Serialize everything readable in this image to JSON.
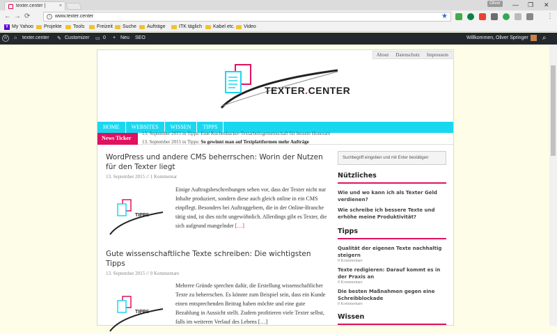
{
  "browser": {
    "tab_title": "texter.center |",
    "tab_close": "×",
    "user_badge": "Oliver",
    "url": "www.texter.center",
    "win_min": "—",
    "win_max": "❐",
    "win_close": "✕",
    "back": "←",
    "forward": "→",
    "reload": "⟳",
    "info": "i",
    "star": "★",
    "menu": "⋮"
  },
  "bookmarks": [
    "My Yahoo",
    "Projekte",
    "Tools",
    "Freizeit",
    "Suche",
    "Aufträge",
    "ITK täglich",
    "Kabel etc.",
    "Video"
  ],
  "wpbar": {
    "wp_logo": "W",
    "site": "texter.center",
    "customizer": "Customizer",
    "comments": "0",
    "new": "Neu",
    "seo": "SEO",
    "greeting": "Willkommen, Oliver Springer",
    "search": "⌕"
  },
  "site": {
    "toplinks": [
      "About",
      "Datenschutz",
      "Impressum"
    ],
    "logo_word": "TEXTER",
    "logo_dot": ".",
    "logo_word2": "CENTER",
    "nav": [
      "HOME",
      "WEBSITES",
      "WISSEN",
      "TIPPS"
    ],
    "ticker_label": "News Ticker",
    "ticker_line1": "13. September 2015 in Tipps: Eine Kuchenbacker-Textarbeitsgemeinschaft für bessere Honorare",
    "ticker_line2_prefix": "13. September 2015 in Tipps:",
    "ticker_line2_title": "So gewinnt man auf Textplattformen mehr Aufträge"
  },
  "posts": [
    {
      "title": "WordPress und andere CMS beherrschen: Worin der Nutzen für den Texter liegt",
      "meta": "13. September 2015 // 1 Kommentar",
      "thumb_label": "TIPPS",
      "excerpt": "Einige Auftragsbeschreibungen sehen vor, dass der Texter nicht nur Inhalte produziert, sondern diese auch gleich online in ein CMS einpflegt. Besonders bei Auftraggebern, die in der Online-Branche tätig sind, ist dies nicht ungewöhnlich. Allerdings gibt es Texter, die sich aufgrund mangelnder",
      "more": "[…]"
    },
    {
      "title": "Gute wissenschaftliche Texte schreiben: Die wichtigsten Tipps",
      "meta": "13. September 2015 // 0 Kommentare",
      "thumb_label": "TIPPS",
      "excerpt": "Mehrere Gründe sprechen dafür, die Erstellung wissenschaftlicher Texte zu beherrschen. Es könnte zum Beispiel sein, dass ein Kunde einen entsprechenden Beitrag haben möchte und eine gute Bezahlung in Aussicht stellt. Zudem profitieren viele Texter selbst, falls im weiteren Verlauf des Lebens […]",
      "more": ""
    }
  ],
  "sidebar": {
    "search_placeholder": "Suchbegriff eingeben und mit Enter bestätigen",
    "w1_title": "Nützliches",
    "w1_links": [
      "Wie und wo kann ich als Texter Geld verdienen?",
      "Wie schreibe ich bessere Texte und erhöhe meine Produktivität?"
    ],
    "w2_title": "Tipps",
    "w2_items": [
      {
        "title": "Qualität der eigenen Texte nachhaltig steigern",
        "count": "0 Kommentare"
      },
      {
        "title": "Texte redigieren: Darauf kommt es in der Praxis an",
        "count": "0 Kommentare"
      },
      {
        "title": "Die besten Maßnahmen gegen eine Schreibblockade",
        "count": "0 Kommentare"
      }
    ],
    "w3_title": "Wissen"
  },
  "colors": {
    "accent": "#e0115f",
    "nav": "#1ad7f0",
    "wpbar": "#23282d"
  }
}
